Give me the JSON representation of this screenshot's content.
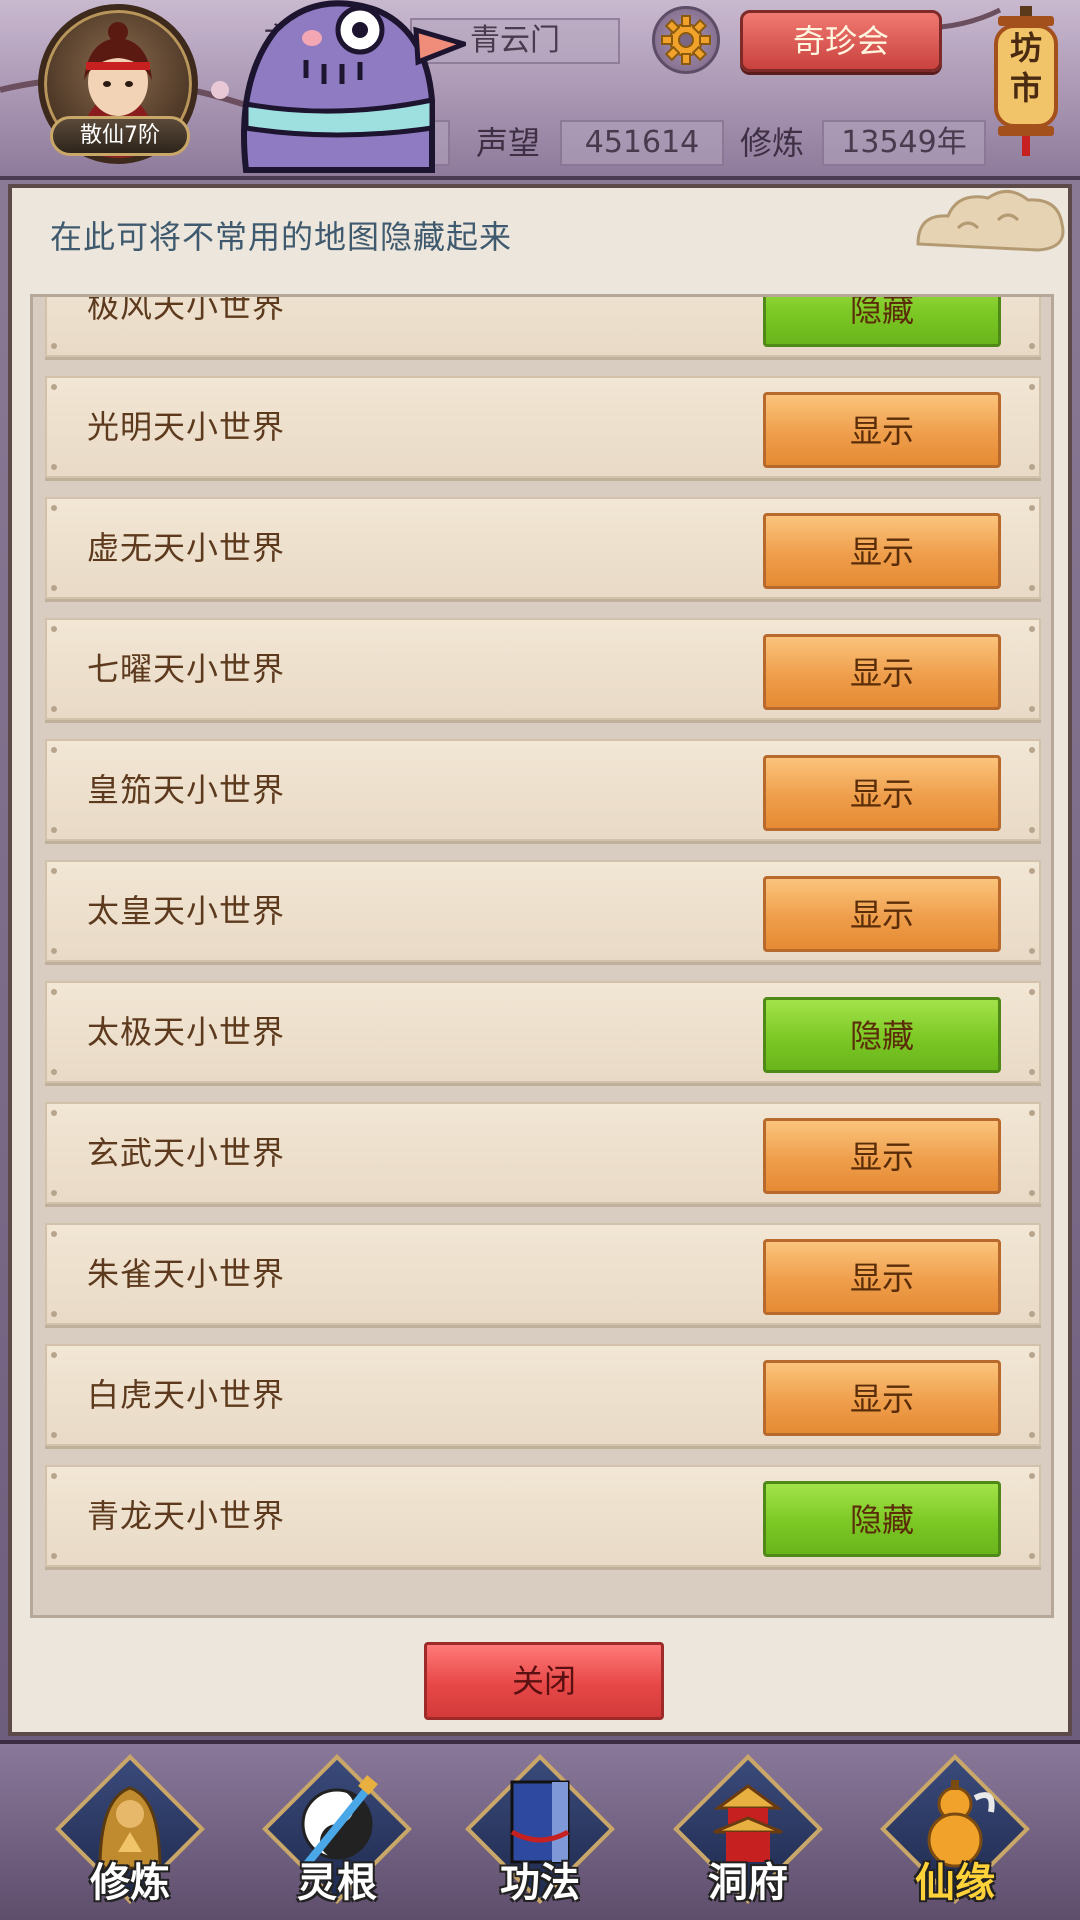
{
  "header": {
    "rank": "散仙7阶",
    "sect": "青云门",
    "reputation_label": "声望",
    "reputation": "451614",
    "cultivation_label": "修炼",
    "cultivation": "13549年",
    "treasure_button": "奇珍会",
    "market": "坊市",
    "partial_text": "主"
  },
  "panel": {
    "title": "在此可将不常用的地图隐藏起来",
    "rows": [
      {
        "name": "极风天小世界",
        "button": "隐藏",
        "state": "hide"
      },
      {
        "name": "光明天小世界",
        "button": "显示",
        "state": "show"
      },
      {
        "name": "虚无天小世界",
        "button": "显示",
        "state": "show"
      },
      {
        "name": "七曜天小世界",
        "button": "显示",
        "state": "show"
      },
      {
        "name": "皇笳天小世界",
        "button": "显示",
        "state": "show"
      },
      {
        "name": "太皇天小世界",
        "button": "显示",
        "state": "show"
      },
      {
        "name": "太极天小世界",
        "button": "隐藏",
        "state": "hide"
      },
      {
        "name": "玄武天小世界",
        "button": "显示",
        "state": "show"
      },
      {
        "name": "朱雀天小世界",
        "button": "显示",
        "state": "show"
      },
      {
        "name": "白虎天小世界",
        "button": "显示",
        "state": "show"
      },
      {
        "name": "青龙天小世界",
        "button": "隐藏",
        "state": "hide"
      }
    ],
    "close_button": "关闭"
  },
  "nav": {
    "items": [
      {
        "label": "修炼",
        "icon": "monk-icon"
      },
      {
        "label": "灵根",
        "icon": "yin-yang-sword-icon"
      },
      {
        "label": "功法",
        "icon": "book-icon"
      },
      {
        "label": "洞府",
        "icon": "pagoda-icon"
      },
      {
        "label": "仙缘",
        "icon": "gourd-icon"
      }
    ]
  },
  "colors": {
    "show_button": "#ef9e4b",
    "hide_button": "#7cc824",
    "close_button": "#e64847",
    "title_text": "#3f5a6e"
  }
}
